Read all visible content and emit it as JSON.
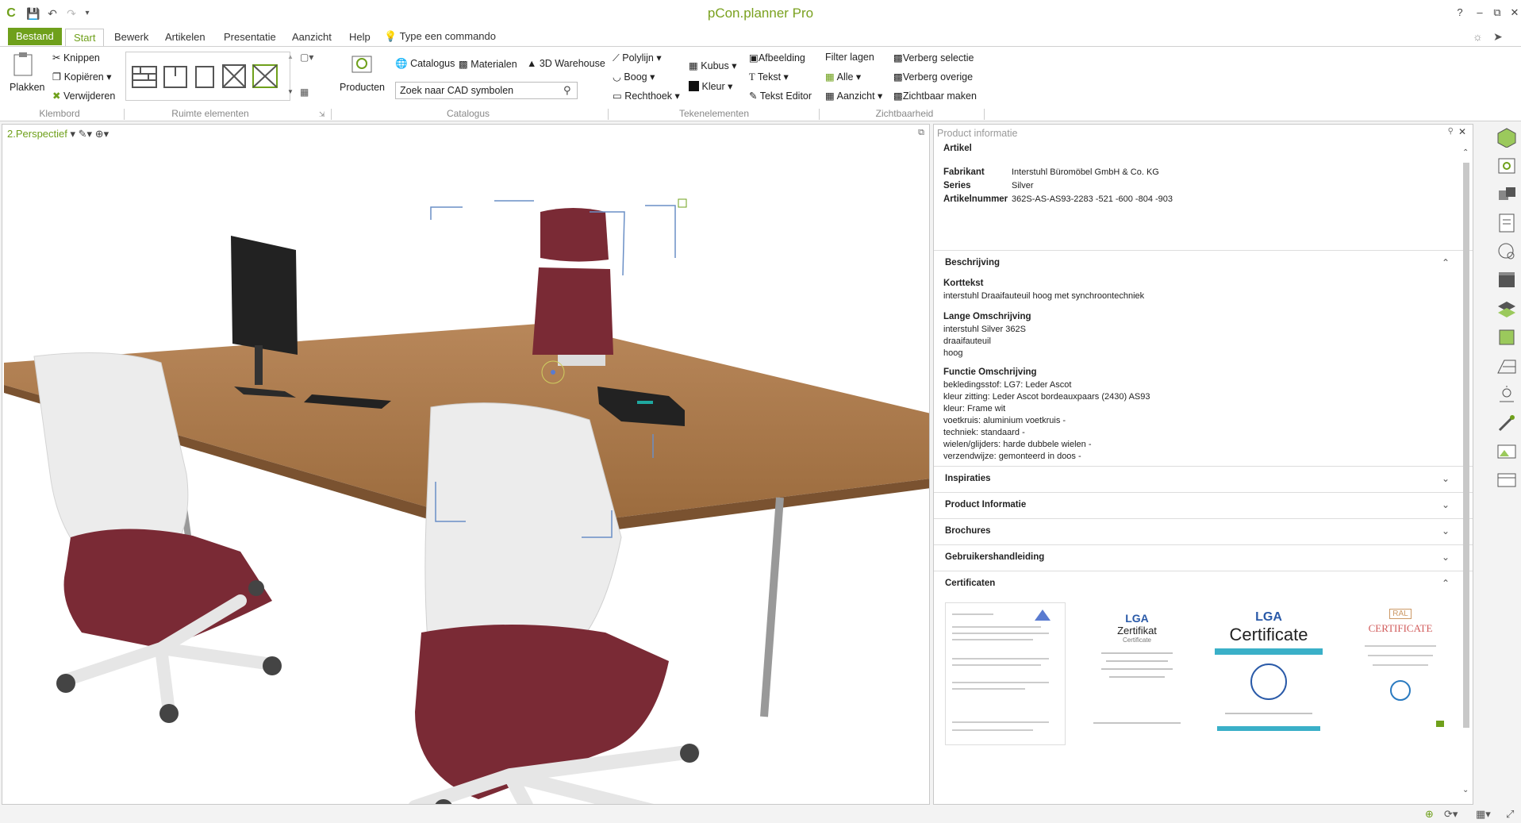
{
  "app": {
    "title": "pCon.planner Pro"
  },
  "menu": {
    "file": "Bestand",
    "tabs": [
      "Start",
      "Bewerk",
      "Artikelen",
      "Presentatie",
      "Aanzicht",
      "Help"
    ],
    "command_hint": "Type een commando"
  },
  "ribbon": {
    "klembord": {
      "paste": "Plakken",
      "cut": "Knippen",
      "copy": "Kopiëren",
      "delete": "Verwijderen",
      "group": "Klembord"
    },
    "ruimte": {
      "group": "Ruimte elementen"
    },
    "producten": "Producten",
    "catalogus": {
      "catalogue": "Catalogus",
      "materials": "Materialen",
      "warehouse": "3D Warehouse",
      "search_placeholder": "Zoek naar CAD symbolen",
      "group": "Catalogus"
    },
    "teken": {
      "polyline": "Polylijn",
      "arc": "Boog",
      "rectangle": "Rechthoek",
      "cube": "Kubus",
      "color": "Kleur",
      "image": "Afbeelding",
      "text": "Tekst",
      "text_editor": "Tekst Editor",
      "group": "Tekenelementen"
    },
    "zicht": {
      "filter": "Filter lagen",
      "all": "Alle",
      "view": "Aanzicht",
      "hide_sel": "Verberg selectie",
      "hide_other": "Verberg overige",
      "make_visible": "Zichtbaar maken",
      "group": "Zichtbaarheid"
    }
  },
  "viewport": {
    "view_name": "2.Perspectief"
  },
  "panel": {
    "title": "Product informatie",
    "artikel_heading": "Artikel",
    "fields": [
      {
        "label": "Fabrikant",
        "value": "Interstuhl Büromöbel GmbH & Co. KG"
      },
      {
        "label": "Series",
        "value": "Silver"
      },
      {
        "label": "Artikelnummer",
        "value": "362S-AS-AS93-2283 -521 -600 -804 -903"
      }
    ],
    "beschrijving": {
      "title": "Beschrijving",
      "korttekst_label": "Korttekst",
      "korttekst": "interstuhl Draaifauteuil hoog met synchroontechniek",
      "lange_label": "Lange Omschrijving",
      "lange": [
        "interstuhl Silver 362S",
        "draaifauteuil",
        "hoog"
      ],
      "functie_label": "Functie Omschrijving",
      "functie": [
        "bekledingsstof: LG7: Leder Ascot",
        "kleur zitting: Leder Ascot bordeauxpaars (2430) AS93",
        "kleur: Frame wit",
        "voetkruis: aluminium voetkruis -",
        "techniek: standaard -",
        "wielen/glijders: harde dubbele wielen -",
        "verzendwijze: gemonteerd in doos -"
      ]
    },
    "sections": [
      "Inspiraties",
      "Product Informatie",
      "Brochures",
      "Gebruikershandleiding"
    ],
    "certificaten": {
      "title": "Certificaten",
      "cert2": {
        "logo": "LGA",
        "title": "Zertifikat",
        "sub": "Certificate"
      },
      "cert3": {
        "logo": "LGA",
        "title": "Certificate"
      },
      "cert4": {
        "logo": "RAL",
        "title": "CERTIFICATE"
      }
    }
  },
  "colors": {
    "accent": "#6fa01b",
    "chair_seat": "#7a2a35",
    "wood": "#a8784a"
  }
}
